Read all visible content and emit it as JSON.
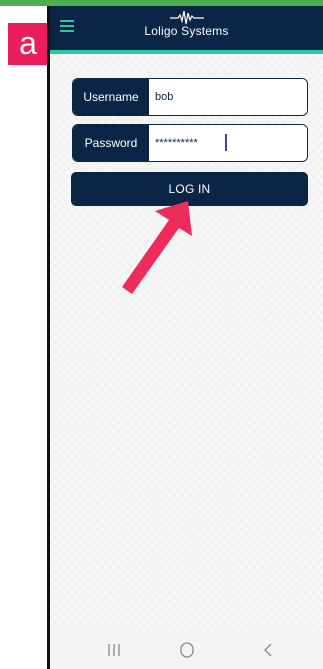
{
  "panel_label": "a",
  "app": {
    "brand_name": "Loligo Systems"
  },
  "login_form": {
    "username_label": "Username",
    "username_value": "bob",
    "password_label": "Password",
    "password_value": "**********",
    "login_button_label": "LOG IN"
  },
  "icons": {
    "menu": "hamburger-menu-icon",
    "logo": "loligo-wave-logo-icon",
    "annotation": "red-pointer-arrow",
    "nav_recents": "recent-apps-icon",
    "nav_home": "home-circle-icon",
    "nav_back": "back-chevron-icon"
  },
  "colors": {
    "header": "#0b2547",
    "accent": "#2fc7a0",
    "panel_label_bg": "#e91e5a",
    "arrow": "#ee2c5a",
    "top_bar": "#4caf50"
  }
}
